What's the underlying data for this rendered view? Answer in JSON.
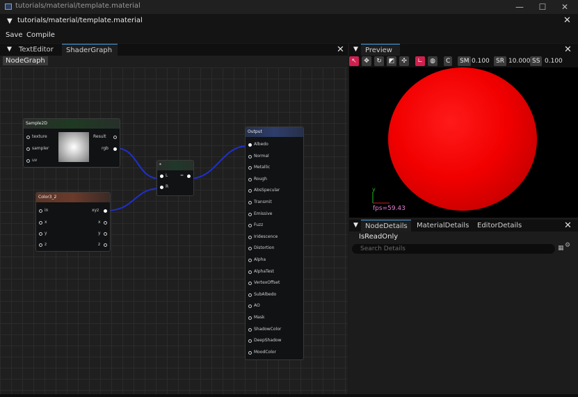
{
  "window": {
    "title": "tutorials/material/template.material",
    "minimize": "—",
    "maximize": "☐",
    "close": "✕"
  },
  "doc": {
    "title": "tutorials/material/template.material",
    "close": "✕"
  },
  "menu": {
    "save": "Save",
    "compile": "Compile"
  },
  "left_tabs": {
    "text_editor": "TextEditor",
    "shader_graph": "ShaderGraph",
    "close": "✕"
  },
  "graph_label": "NodeGraph",
  "nodes": {
    "sample2d": {
      "title": "Sample2D",
      "inputs": [
        "texture",
        "sampler",
        "uv"
      ],
      "outputs": [
        "Result",
        "rgb"
      ]
    },
    "color": {
      "title": "Color3_2",
      "inputs": [
        "in",
        "x",
        "y",
        "z"
      ],
      "outputs": [
        "xyz",
        "x",
        "y",
        "z"
      ]
    },
    "multiply": {
      "title": "*",
      "inputs": [
        "L",
        "R"
      ],
      "output": "="
    },
    "output": {
      "title": "Output",
      "inputs": [
        "Albedo",
        "Normal",
        "Metallic",
        "Rough",
        "AbsSpecular",
        "Transmit",
        "Emissive",
        "Fuzz",
        "Iridescence",
        "Distortion",
        "Alpha",
        "AlphaTest",
        "VertexOffset",
        "SubAlbedo",
        "AO",
        "Mask",
        "ShadowColor",
        "DeepShadow",
        "MoodColor"
      ]
    }
  },
  "preview": {
    "tab": "Preview",
    "close": "✕",
    "toolbar": {
      "c": "C",
      "sm_label": "SM",
      "sm_value": "0.100",
      "sr_label": "SR",
      "sr_value": "10.000",
      "ss_label": "SS",
      "ss_value": "0.100"
    },
    "axis_label": "y",
    "fps": "fps=59.43",
    "sphere_color": "#ff0000"
  },
  "details": {
    "tabs": [
      "NodeDetails",
      "MaterialDetails",
      "EditorDetails"
    ],
    "close": "✕",
    "readonly": "IsReadOnly",
    "search_placeholder": "Search Details"
  }
}
